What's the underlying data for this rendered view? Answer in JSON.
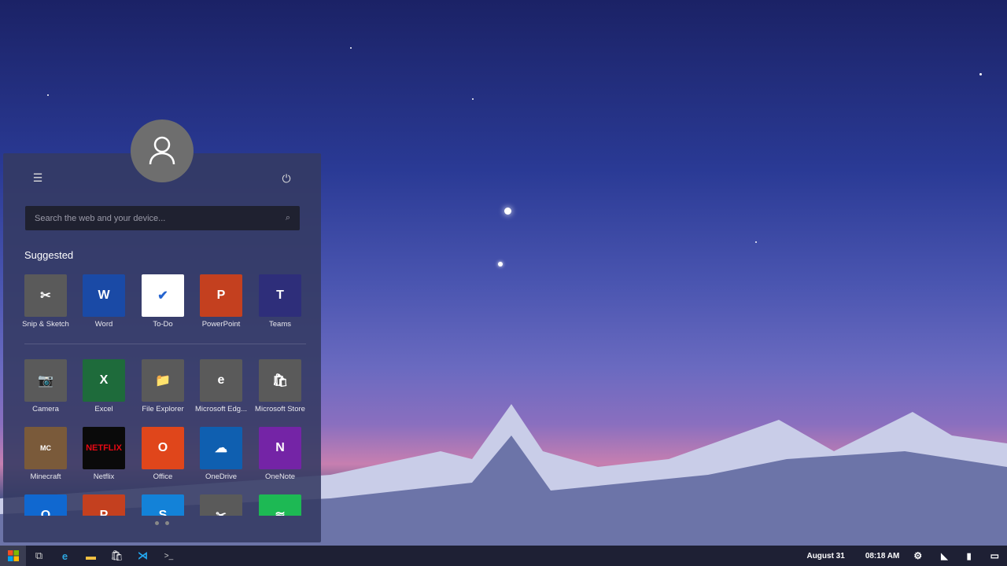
{
  "start_menu": {
    "search_placeholder": "Search the web and your device...",
    "suggested_label": "Suggested",
    "suggested": [
      {
        "label": "Snip & Sketch",
        "color": "#5a5a5a",
        "glyph": "✂"
      },
      {
        "label": "Word",
        "color": "#1a4aa6",
        "glyph": "W"
      },
      {
        "label": "To-Do",
        "color": "#ffffff",
        "glyph": "✔"
      },
      {
        "label": "PowerPoint",
        "color": "#c4401f",
        "glyph": "P"
      },
      {
        "label": "Teams",
        "color": "#2e2e7a",
        "glyph": "T"
      }
    ],
    "pinned": [
      {
        "label": "Camera",
        "color": "#5a5a5a",
        "glyph": "📷"
      },
      {
        "label": "Excel",
        "color": "#1e6b3b",
        "glyph": "X"
      },
      {
        "label": "File Explorer",
        "color": "#5a5a5a",
        "glyph": "📁"
      },
      {
        "label": "Microsoft Edg...",
        "color": "#5a5a5a",
        "glyph": "e"
      },
      {
        "label": "Microsoft Store",
        "color": "#5a5a5a",
        "glyph": "🛍"
      },
      {
        "label": "Minecraft",
        "color": "#7a5a3a",
        "glyph": "MC"
      },
      {
        "label": "Netflix",
        "color": "#0a0a0a",
        "glyph": "NETFLIX"
      },
      {
        "label": "Office",
        "color": "#e0461b",
        "glyph": "O"
      },
      {
        "label": "OneDrive",
        "color": "#0f5fb0",
        "glyph": "☁"
      },
      {
        "label": "OneNote",
        "color": "#7424a6",
        "glyph": "N"
      }
    ],
    "partial_row": [
      {
        "color": "#1068d0",
        "glyph": "O"
      },
      {
        "color": "#c4401f",
        "glyph": "P"
      },
      {
        "color": "#1382d8",
        "glyph": "S"
      },
      {
        "color": "#5a5a5a",
        "glyph": "✂"
      },
      {
        "color": "#1db954",
        "glyph": "≋"
      }
    ]
  },
  "taskbar": {
    "date": "August 31",
    "time": "08:18 AM"
  }
}
